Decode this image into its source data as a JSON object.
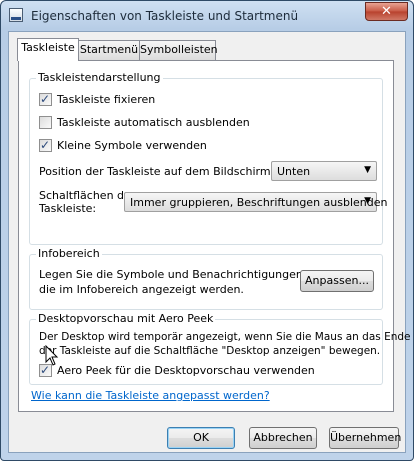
{
  "window": {
    "title": "Eigenschaften von Taskleiste und Startmenü",
    "close_glyph": "✕",
    "icon": "taskbar-properties-icon"
  },
  "tabs": [
    {
      "label": "Taskleiste",
      "active": true
    },
    {
      "label": "Startmenü",
      "active": false
    },
    {
      "label": "Symbolleisten",
      "active": false
    }
  ],
  "taskbar_appearance": {
    "title": "Taskleistendarstellung",
    "lock_taskbar": {
      "label": "Taskleiste fixieren",
      "checked": true
    },
    "autohide": {
      "label": "Taskleiste automatisch ausblenden",
      "checked": false
    },
    "small_icons": {
      "label": "Kleine Symbole verwenden",
      "checked": true
    },
    "position_label": "Position der Taskleiste auf dem Bildschirm:",
    "position_value": "Unten",
    "buttons_label_line1": "Schaltflächen der",
    "buttons_label_line2": "Taskleiste:",
    "buttons_value": "Immer gruppieren, Beschriftungen ausblenden"
  },
  "notification_area": {
    "title": "Infobereich",
    "text_line1": "Legen Sie die Symbole und Benachrichtigungen fest,",
    "text_line2": "die im Infobereich angezeigt werden.",
    "customize_button": "Anpassen..."
  },
  "aero_peek": {
    "title": "Desktopvorschau mit Aero Peek",
    "text_line1": "Der Desktop wird temporär angezeigt, wenn Sie die Maus an das Ende",
    "text_line2": "der Taskleiste auf die Schaltfläche \"Desktop anzeigen\" bewegen.",
    "use_peek": {
      "label": "Aero Peek für die Desktopvorschau verwenden",
      "checked": true
    }
  },
  "help_link": "Wie kann die Taskleiste angepasst werden?",
  "footer": {
    "ok": "OK",
    "cancel": "Abbrechen",
    "apply": "Übernehmen"
  },
  "colors": {
    "link": "#0066cc",
    "close_button": "#c75844",
    "title_bar": "#bfd3ea"
  }
}
